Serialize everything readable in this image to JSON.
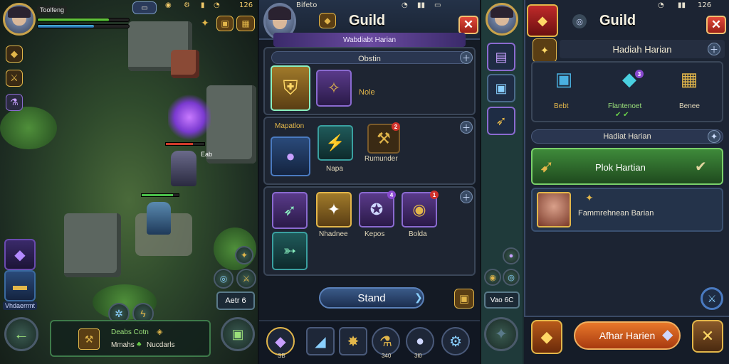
{
  "panel1": {
    "player_name": "Toolfeng",
    "health_fraction": 0.78,
    "mana_fraction": 0.62,
    "enemy_level": "Eab",
    "counter_label": "Aetr 6",
    "quest": {
      "title": "Deabs Cotn",
      "line2_left": "Mmahs",
      "line2_right": "Nucdarls"
    },
    "skill_label": "Vhdaerrmt",
    "icons": {
      "back": "back-arrow-icon",
      "bag": "backpack-icon"
    }
  },
  "panel2": {
    "status_text": "Bifeto",
    "title": "Guild",
    "subtitle": "Wabdiabt Harian",
    "section_header": "Obstin",
    "item_note": "Nole",
    "section2_label": "Mapatlon",
    "item_mage": "Napa",
    "item_hammer": "Rumunder",
    "row3": [
      "Nhadnee",
      "Kepos",
      "Bolda"
    ],
    "start_button": "Stand",
    "hotbar_numbers": [
      "SB",
      "340",
      "3l0"
    ],
    "badge_counts": [
      "2",
      "4",
      "1"
    ]
  },
  "panel3": {
    "time": "126",
    "title": "Guild",
    "daily_header": "Hadiah Harian",
    "rewards": [
      "Bebt",
      "Flantenoet",
      "Benee"
    ],
    "sub_header": "Hadiat Harian",
    "claim_row": "Plok Hartian",
    "hero_row": "Fammrehnean Barian",
    "counter": "Vao 6C",
    "action_button": "Afhar Harien",
    "hp_badge": "3"
  },
  "colors": {
    "gold": "#e2b64a",
    "purple": "#6a4ab0",
    "green_claim": "#3e8a3a",
    "orange_button": "#d25a1a",
    "close_red": "#d03a2a"
  }
}
